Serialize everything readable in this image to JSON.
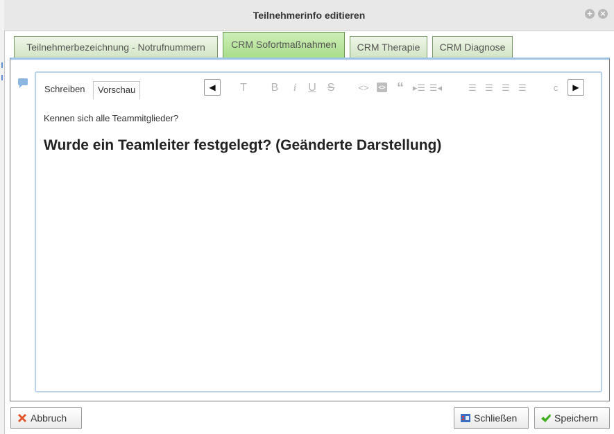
{
  "window": {
    "title": "Teilnehmerinfo editieren"
  },
  "tabs": [
    {
      "label": "Teilnehmerbezeichnung - Notrufnummern"
    },
    {
      "label": "CRM Sofortmaßnahmen",
      "active": true
    },
    {
      "label": "CRM Therapie"
    },
    {
      "label": "CRM Diagnose"
    }
  ],
  "editor": {
    "mode_tabs": [
      {
        "label": "Schreiben"
      },
      {
        "label": "Vorschau",
        "active": true
      }
    ],
    "toolbar_icons": [
      "text-style",
      "bold",
      "italic",
      "underline",
      "strikethrough",
      "code-inline",
      "code-block",
      "quote",
      "indent",
      "outdent",
      "align-left",
      "align-center",
      "align-right",
      "justify",
      "more"
    ],
    "toolbar_glyphs": {
      "text": "T",
      "bold": "B",
      "italic": "i",
      "underline": "U",
      "strike": "S",
      "code": "<>",
      "code_block": "</>",
      "quote": "“",
      "indent": "▸☰",
      "outdent": "☰◂",
      "more": "c"
    },
    "content": {
      "paragraph": "Kennen sich alle Teammitglieder?",
      "heading": "Wurde ein Teamleiter festgelegt? (Geänderte Darstellung)"
    }
  },
  "footer": {
    "cancel_label": "Abbruch",
    "close_label": "Schließen",
    "save_label": "Speichern"
  },
  "colors": {
    "active_tab": "#a9dd8a",
    "inactive_tab": "#d2e4c4",
    "editor_border": "#b9d2ea",
    "cancel_icon": "#e2532b",
    "save_icon": "#3fae1d"
  }
}
